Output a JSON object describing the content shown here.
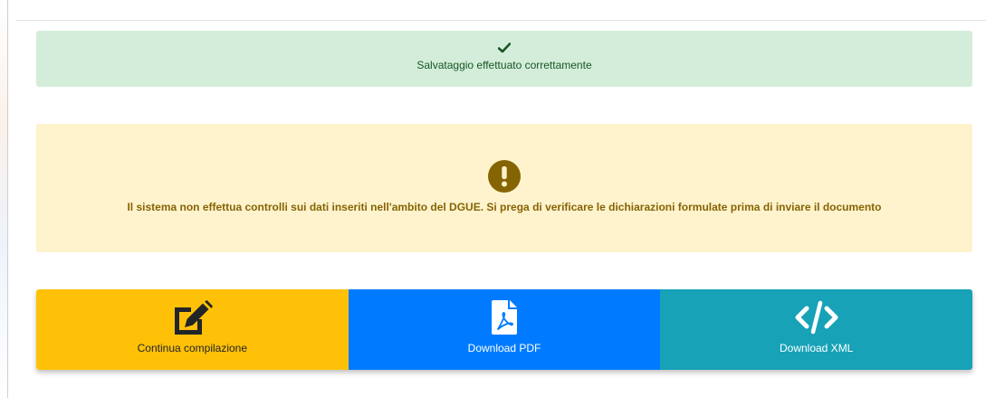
{
  "success_alert": {
    "icon": "check-icon",
    "message": "Salvataggio effettuato correttamente",
    "color": "#155724",
    "background": "#d4edda"
  },
  "warning_alert": {
    "icon": "exclamation-circle-icon",
    "message": "Il sistema non effettua controlli sui dati inseriti nell'ambito del DGUE. Si prega di verificare le dichiarazioni formulate prima di inviare il documento",
    "color": "#856404",
    "background": "#fff3cd"
  },
  "actions": [
    {
      "label": "Continua compilazione",
      "icon": "edit-icon",
      "background": "#ffc107"
    },
    {
      "label": "Download PDF",
      "icon": "file-pdf-icon",
      "background": "#007bff"
    },
    {
      "label": "Download XML",
      "icon": "code-icon",
      "background": "#17a2b8"
    }
  ]
}
